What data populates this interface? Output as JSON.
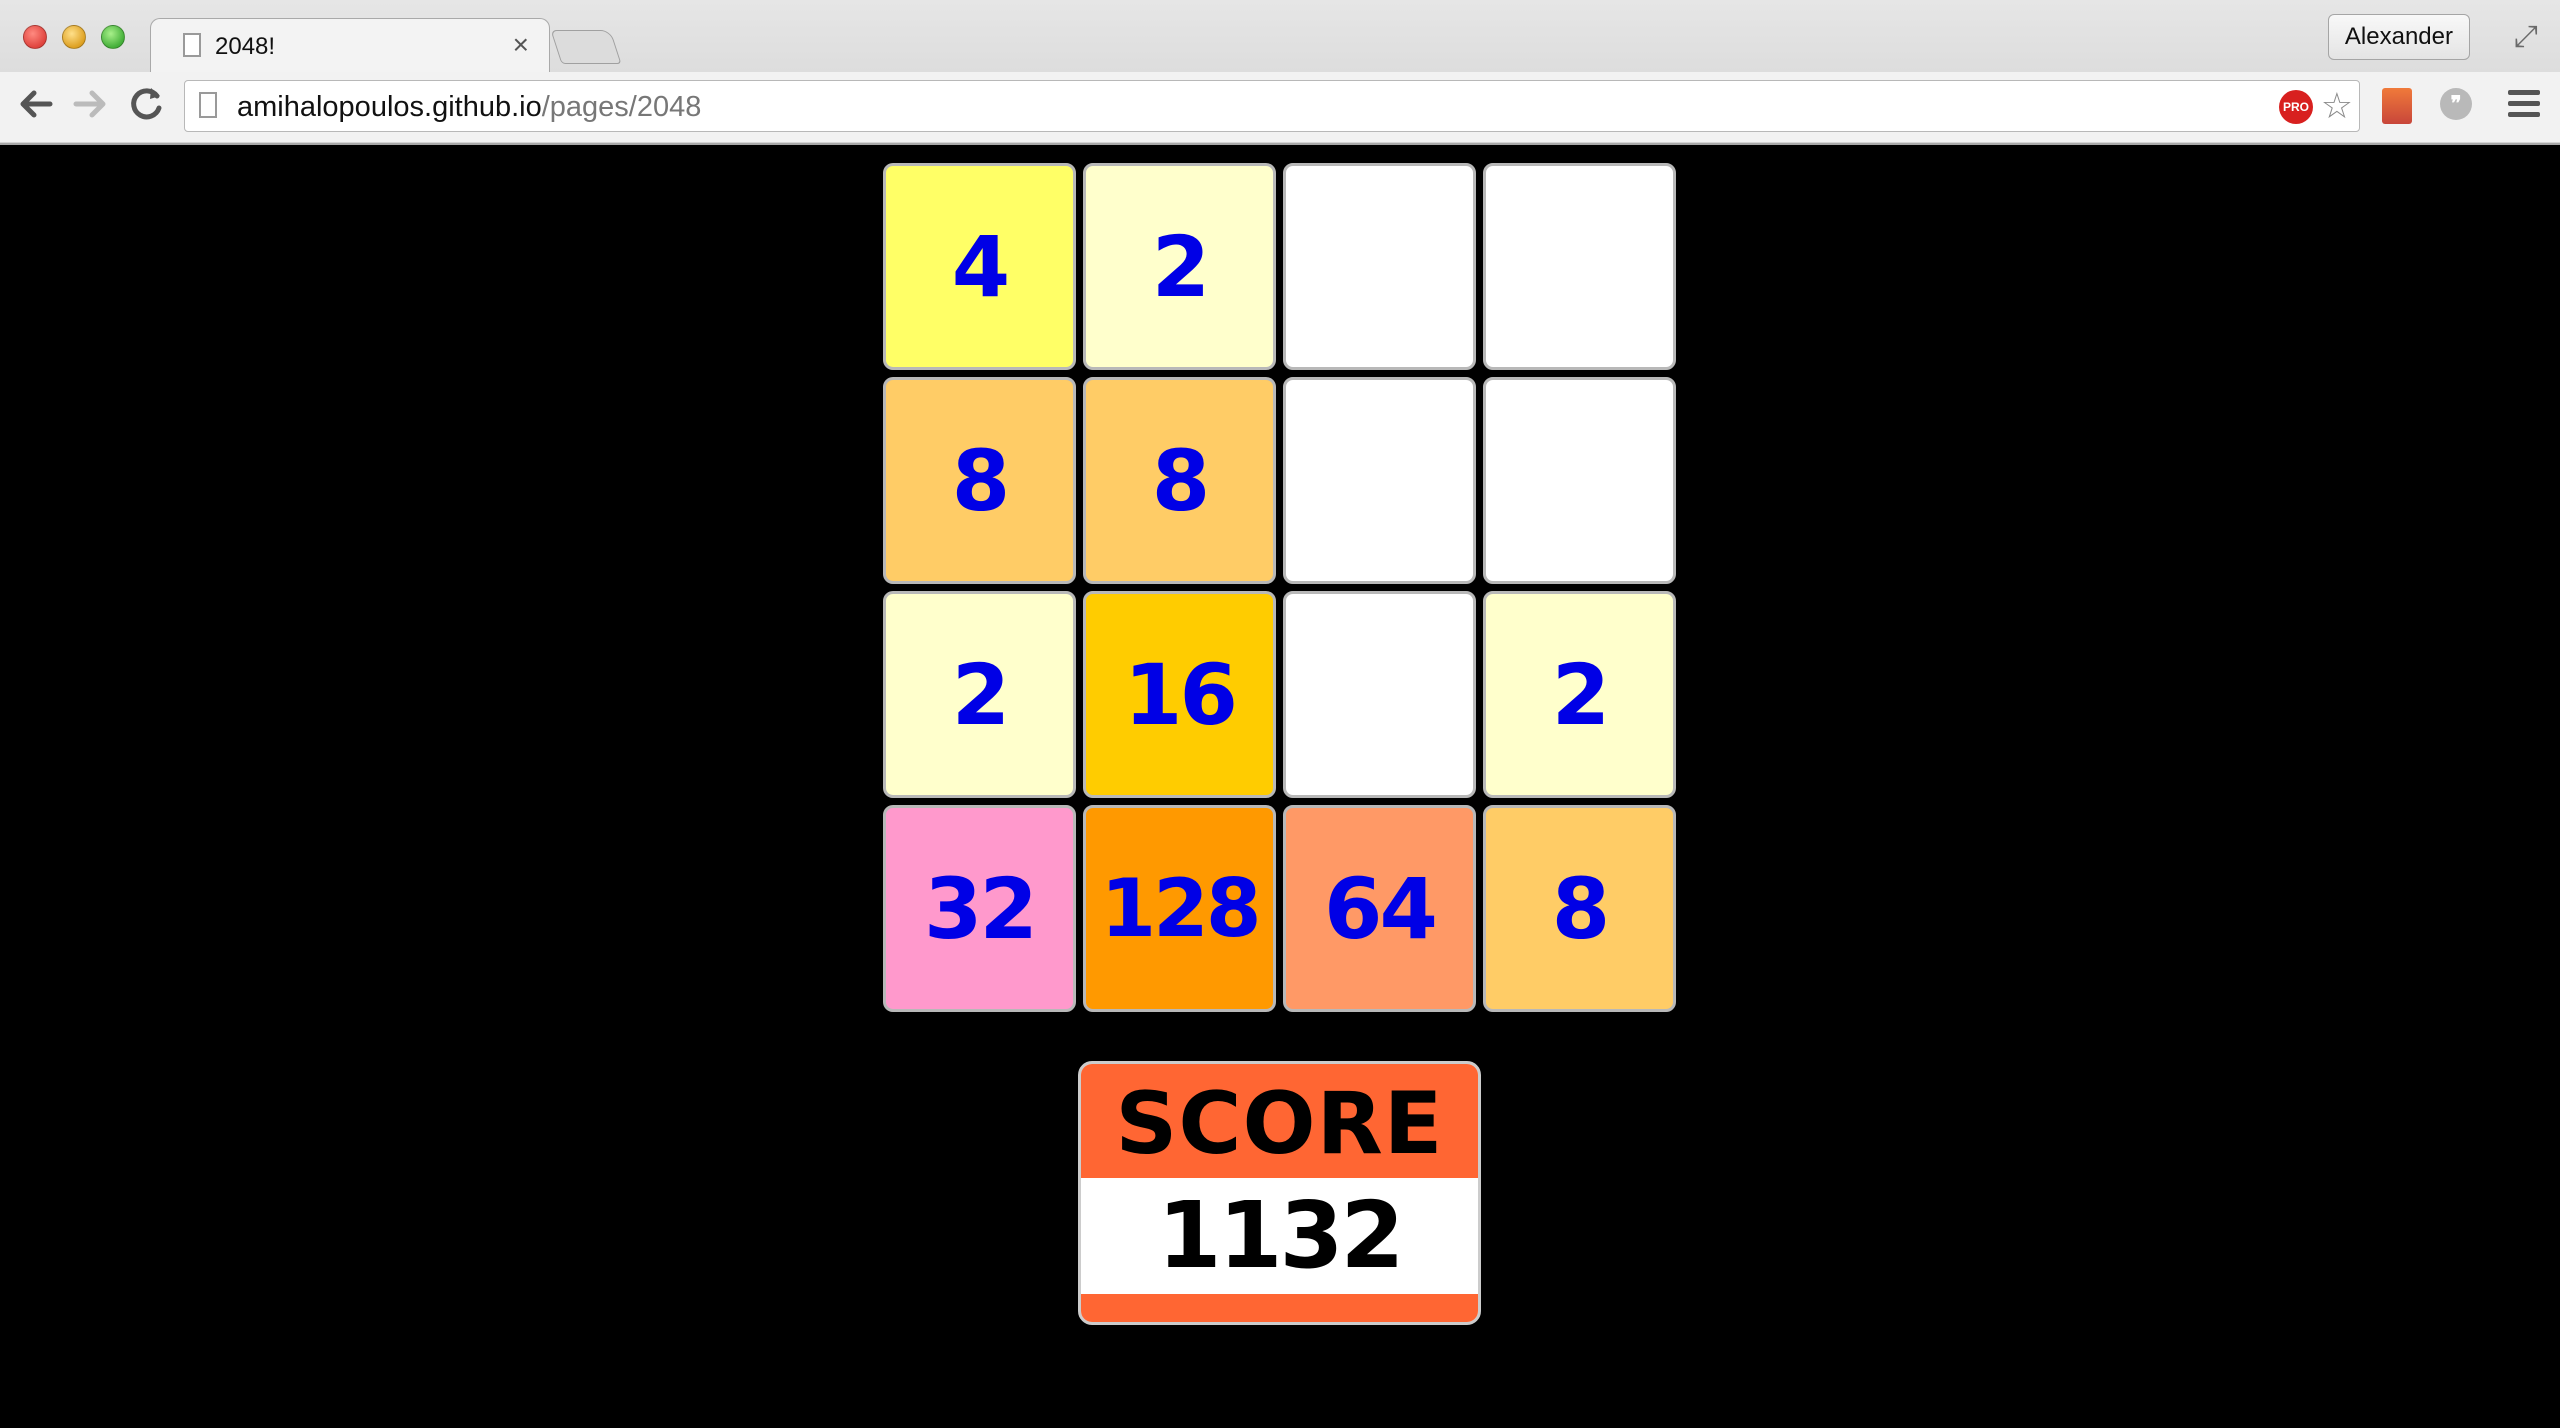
{
  "browser": {
    "tab_title": "2048!",
    "tab_close": "×",
    "profile_name": "Alexander",
    "url_host": "amihalopoulos.github.io",
    "url_path": "/pages/2048",
    "pro_badge": "PRO",
    "icons": [
      "page-icon",
      "close-icon",
      "back-arrow-icon",
      "forward-arrow-icon",
      "reload-icon",
      "bookmark-star-icon",
      "extension-icon",
      "speech-bubble-icon",
      "menu-icon",
      "fullscreen-icon"
    ]
  },
  "game": {
    "tiles": [
      {
        "value": "4",
        "color": "#ffff66"
      },
      {
        "value": "2",
        "color": "#ffffcc"
      },
      {
        "value": "",
        "color": "#ffffff"
      },
      {
        "value": "",
        "color": "#ffffff"
      },
      {
        "value": "8",
        "color": "#ffcc66"
      },
      {
        "value": "8",
        "color": "#ffcc66"
      },
      {
        "value": "",
        "color": "#ffffff"
      },
      {
        "value": "",
        "color": "#ffffff"
      },
      {
        "value": "2",
        "color": "#ffffcc"
      },
      {
        "value": "16",
        "color": "#ffcc00"
      },
      {
        "value": "",
        "color": "#ffffff"
      },
      {
        "value": "2",
        "color": "#ffffcc"
      },
      {
        "value": "32",
        "color": "#ff99cc"
      },
      {
        "value": "128",
        "color": "#ff9900"
      },
      {
        "value": "64",
        "color": "#ff9966"
      },
      {
        "value": "8",
        "color": "#ffcc66"
      }
    ],
    "tile_text_color": "#0000e6",
    "score_label": "SCORE",
    "score_value": "1132",
    "score_accent": "#ff6633"
  }
}
